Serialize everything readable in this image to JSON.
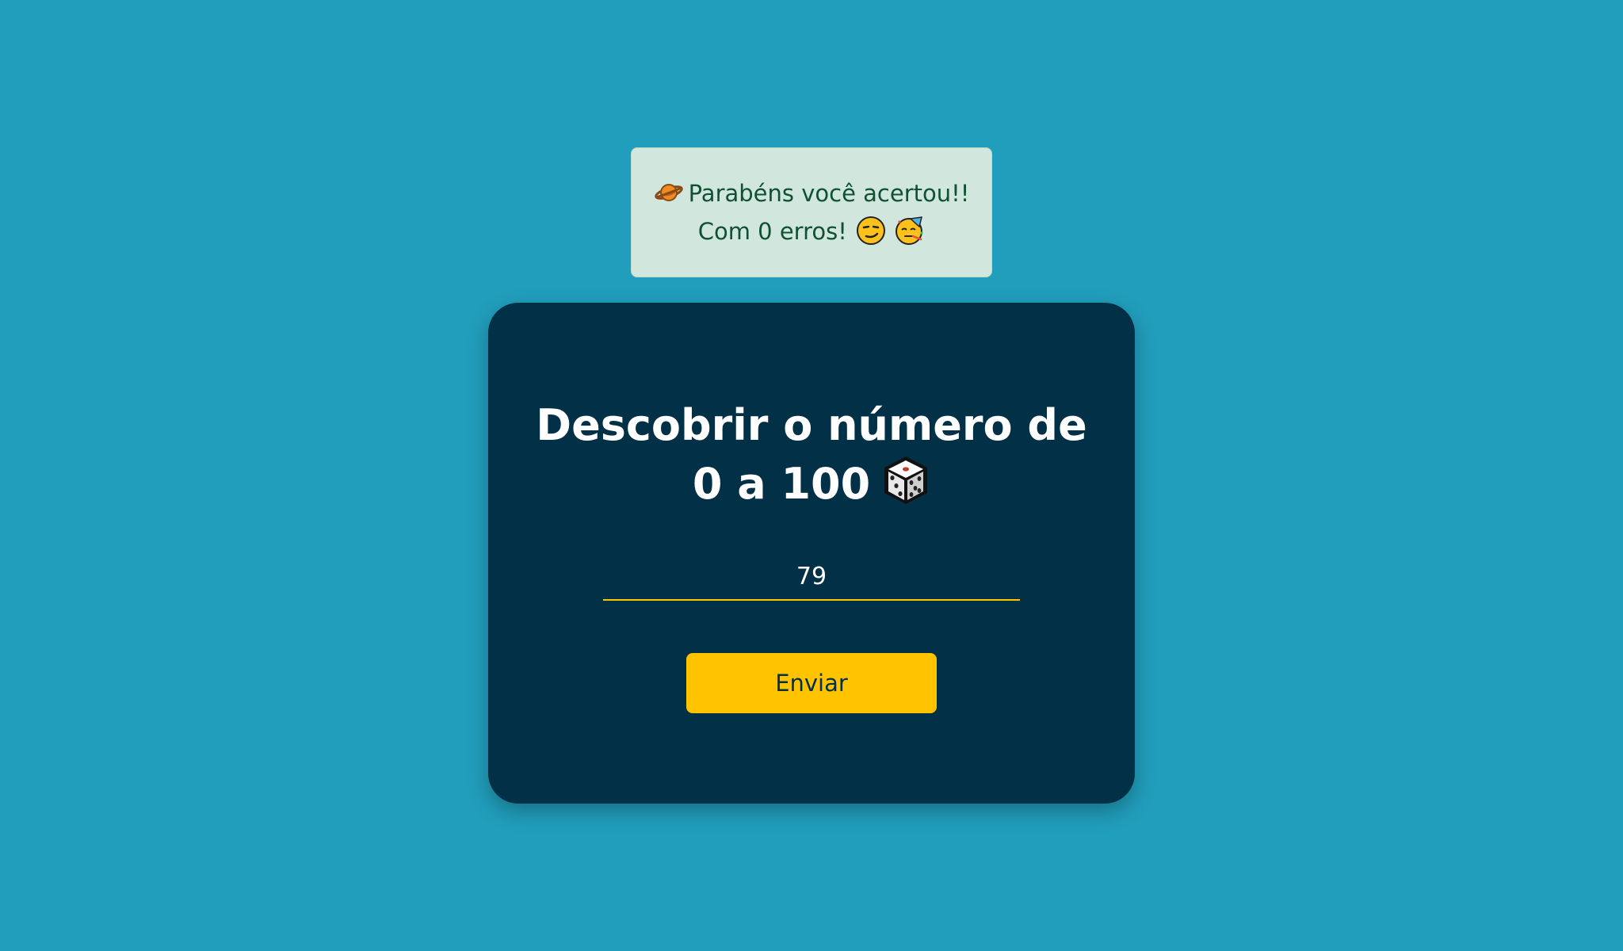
{
  "toast": {
    "icon": "planet-icon",
    "line1": "Parabéns você acertou!!",
    "line2": "Com 0 erros!",
    "trailing_icons": [
      "smirking-face-icon",
      "partying-face-icon"
    ],
    "background_color": "#d1e7dd",
    "text_color": "#0f5132"
  },
  "game": {
    "title_line1": "Descobrir o número de",
    "title_line2": "0 a 100",
    "title_icon": "dice-icon",
    "guess_value": "79",
    "submit_label": "Enviar",
    "card_color": "#023047",
    "accent_color": "#ffc300"
  },
  "page": {
    "background_color": "#219ebc"
  }
}
